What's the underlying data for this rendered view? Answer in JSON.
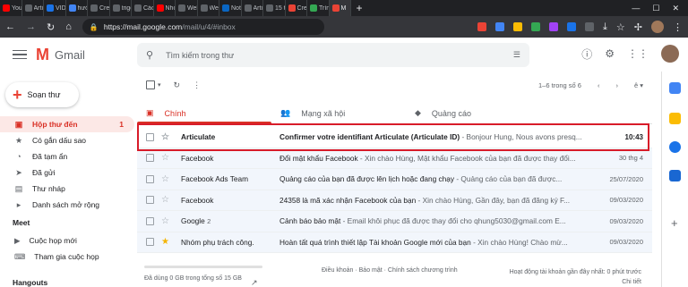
{
  "browser": {
    "tabs": [
      {
        "label": "You!",
        "color": "#ff0000"
      },
      {
        "label": "Article",
        "color": "#5f6368"
      },
      {
        "label": "VIDIO",
        "color": "#1a73e8"
      },
      {
        "label": "hướ",
        "color": "#4285f4"
      },
      {
        "label": "Crea",
        "color": "#5f6368"
      },
      {
        "label": "trigo",
        "color": "#5f6368"
      },
      {
        "label": "Cách",
        "color": "#5f6368"
      },
      {
        "label": "Nhờ",
        "color": "#ff0000"
      },
      {
        "label": "Web",
        "color": "#5f6368"
      },
      {
        "label": "Web",
        "color": "#5f6368"
      },
      {
        "label": "Noti",
        "color": "#0a66c2"
      },
      {
        "label": "Arti",
        "color": "#5f6368"
      },
      {
        "label": "15 t",
        "color": "#5f6368"
      },
      {
        "label": "Crea",
        "color": "#ea4335"
      },
      {
        "label": "Trình",
        "color": "#34a853"
      },
      {
        "label": "M",
        "color": "#ea4335"
      }
    ],
    "new_tab": "+",
    "url_host": "https://mail.google.com",
    "url_path": "/mail/u/4/#inbox"
  },
  "gmail": {
    "logo_text": "Gmail",
    "search_placeholder": "Tìm kiếm trong thư",
    "compose_label": "Soạn thư",
    "nav": [
      {
        "label": "Hộp thư đến",
        "count": "1",
        "icon": "inbox-icon",
        "glyph": "▣",
        "active": true
      },
      {
        "label": "Có gắn dấu sao",
        "count": "",
        "icon": "star-icon",
        "glyph": "★",
        "active": false
      },
      {
        "label": "Đã tạm ẩn",
        "count": "",
        "icon": "clock-icon",
        "glyph": "◔",
        "active": false
      },
      {
        "label": "Đã gửi",
        "count": "",
        "icon": "send-icon",
        "glyph": "➤",
        "active": false
      },
      {
        "label": "Thư nháp",
        "count": "",
        "icon": "draft-icon",
        "glyph": "▤",
        "active": false
      },
      {
        "label": "Danh sách mở rộng",
        "count": "",
        "icon": "label-icon",
        "glyph": "▸",
        "active": false
      }
    ],
    "meet": {
      "title": "Meet",
      "new_meeting": "Cuộc họp mới",
      "join_meeting": "Tham gia cuộc họp"
    },
    "hangouts": "Hangouts",
    "pager": "1–6 trong số 6",
    "categories": [
      {
        "label": "Chính",
        "icon": "inbox-icon"
      },
      {
        "label": "Mạng xã hội",
        "icon": "people-icon"
      },
      {
        "label": "Quảng cáo",
        "icon": "tag-icon"
      }
    ],
    "emails": [
      {
        "sender": "Articulate",
        "count": "",
        "subject": "Confirmer votre identifiant Articulate (Articulate ID)",
        "preview": " - Bonjour Hung, Nous avons presq...",
        "date": "10:43",
        "unread": true,
        "starred": false
      },
      {
        "sender": "Facebook",
        "count": "",
        "subject": "Đổi mật khẩu Facebook",
        "preview": " - Xin chào Hùng, Mật khẩu Facebook của bạn đã được thay đổi...",
        "date": "30 thg 4",
        "unread": false,
        "starred": false
      },
      {
        "sender": "Facebook Ads Team",
        "count": "",
        "subject": "Quảng cáo của bạn đã được lên lịch hoặc đang chạy",
        "preview": " - Quảng cáo của bạn đã được...",
        "date": "25/07/2020",
        "unread": false,
        "starred": false
      },
      {
        "sender": "Facebook",
        "count": "",
        "subject": "24358 là mã xác nhận Facebook của bạn",
        "preview": " - Xin chào Hùng, Gần đây, bạn đã đăng ký F...",
        "date": "09/03/2020",
        "unread": false,
        "starred": false
      },
      {
        "sender": "Google",
        "count": "2",
        "subject": "Cảnh báo bảo mật",
        "preview": " - Email khôi phục đã được thay đổi cho qhung5030@gmail.com E...",
        "date": "09/03/2020",
        "unread": false,
        "starred": false
      },
      {
        "sender": "Nhóm phụ trách công.",
        "count": "",
        "subject": "Hoàn tất quá trình thiết lập Tài khoản Google mới của bạn",
        "preview": " - Xin chào Hùng! Chào mừ...",
        "date": "09/03/2020",
        "unread": false,
        "starred": true
      }
    ],
    "footer": {
      "storage": "Đã dùng 0 GB trong tổng số 15 GB",
      "terms": "Điều khoản · Bảo mật · Chính sách chương trình",
      "activity": "Hoạt động tài khoản gần đây nhất: 0 phút trước",
      "details": "Chi tiết"
    }
  }
}
